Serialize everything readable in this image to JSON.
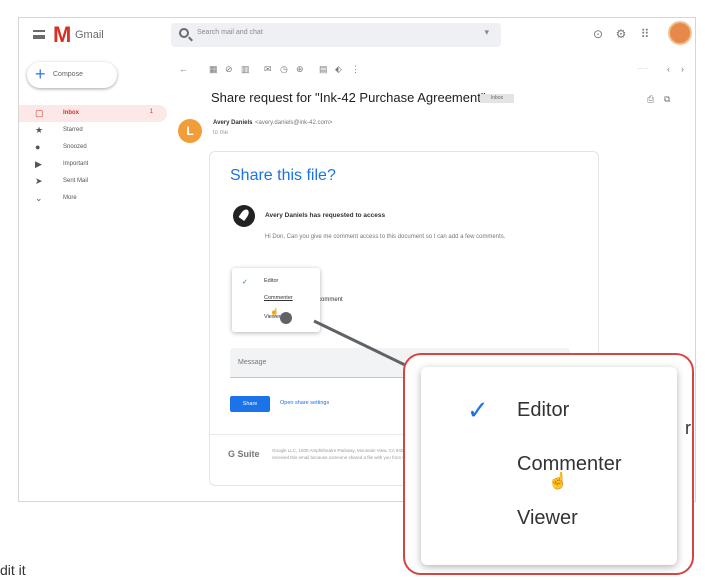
{
  "app": {
    "name": "Gmail",
    "logo": "M"
  },
  "search": {
    "placeholder": "Search mail and chat",
    "icon": "search-icon"
  },
  "compose": {
    "label": "Compose"
  },
  "sidebar": {
    "items": [
      {
        "label": "Inbox",
        "count": "1",
        "icon": "inbox-icon",
        "glyph": "▢"
      },
      {
        "label": "Starred",
        "icon": "star-icon",
        "glyph": "★"
      },
      {
        "label": "Snoozed",
        "icon": "clock-icon",
        "glyph": "●"
      },
      {
        "label": "Important",
        "icon": "important-icon",
        "glyph": "▶"
      },
      {
        "label": "Sent Mail",
        "icon": "send-icon",
        "glyph": "➤"
      },
      {
        "label": "More",
        "icon": "chevron-down-icon",
        "glyph": "⌄"
      }
    ]
  },
  "email": {
    "subject": "Share request for \"Ink-42 Purchase Agreement\"",
    "badge": "Inbox",
    "sender": {
      "initial": "L",
      "name": "Avery Daniels",
      "email": "<avery.daniels@ink-42.com>",
      "to": "to me"
    },
    "card": {
      "title": "Share this file?",
      "request": "Avery Daniels has requested to access",
      "message": "Hi Don, Can you give me comment access to this document so I can add a few comments.",
      "allow_text": "comment",
      "message_placeholder": "Message",
      "share_label": "Share",
      "settings_link": "Open share settings",
      "gsuite": "G Suite",
      "footer": "Google LLC, 1600 Amphitheatre Parkway, Mountain View, CA 94043, USA. You have received this email because someone shared a file with you from Google Docs."
    }
  },
  "permission_menu": {
    "options": [
      "Editor",
      "Commenter",
      "Viewer"
    ],
    "selected": "Editor"
  },
  "zoom": {
    "partial_text": "r"
  },
  "caption": "dit it"
}
